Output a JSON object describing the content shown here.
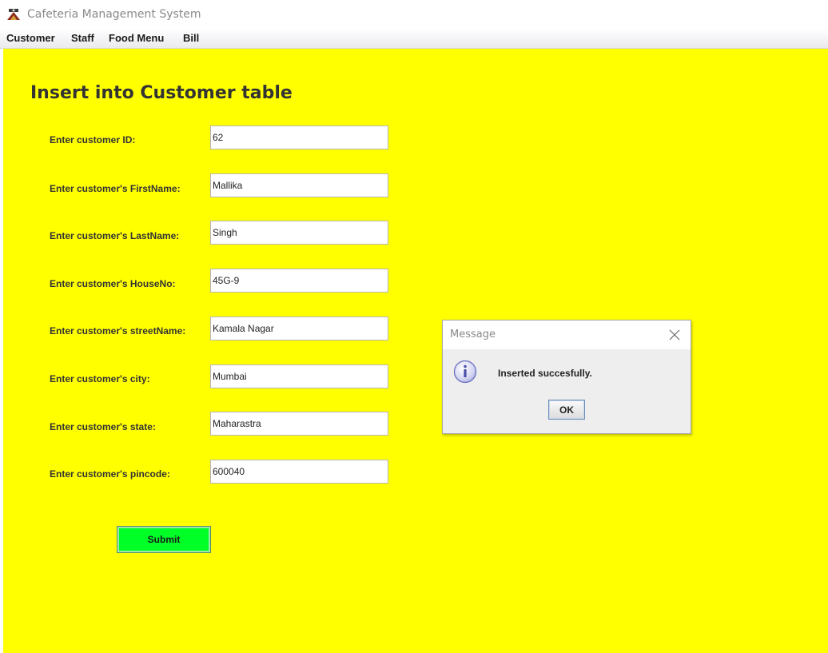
{
  "window": {
    "title": "Cafeteria Management System"
  },
  "menu": {
    "items": [
      "Customer",
      "Staff",
      "Food Menu",
      "Bill"
    ]
  },
  "form": {
    "heading": "Insert into Customer table",
    "fields": [
      {
        "label": "Enter customer ID:",
        "value": "62"
      },
      {
        "label": "Enter customer's FirstName:",
        "value": "Mallika"
      },
      {
        "label": "Enter customer's LastName:",
        "value": "Singh"
      },
      {
        "label": "Enter customer's HouseNo:",
        "value": "45G-9"
      },
      {
        "label": "Enter customer's streetName:",
        "value": "Kamala Nagar"
      },
      {
        "label": "Enter customer's city:",
        "value": "Mumbai"
      },
      {
        "label": "Enter customer's state:",
        "value": "Maharastra"
      },
      {
        "label": "Enter customer's pincode:",
        "value": "600040"
      }
    ],
    "submit_label": "Submit"
  },
  "dialog": {
    "title": "Message",
    "message": "Inserted succesfully.",
    "ok_label": "OK",
    "icon": "info-icon",
    "close_icon": "close-icon"
  },
  "colors": {
    "background": "#ffff00",
    "submit_button": "#00ff27",
    "heading_text": "#333333"
  }
}
